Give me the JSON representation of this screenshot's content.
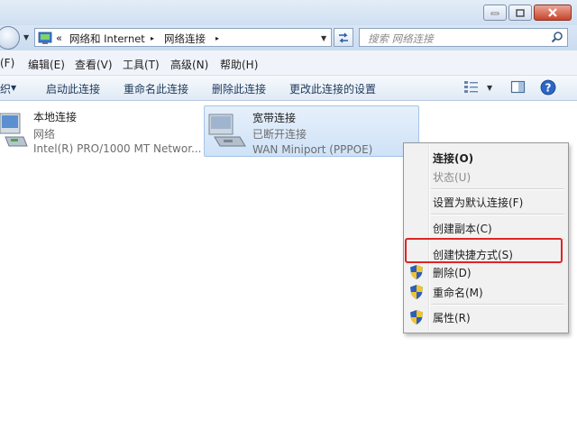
{
  "address": {
    "breadcrumb_prefix": "«",
    "crumb1": "网络和 Internet",
    "crumb2": "网络连接",
    "sep": "▸",
    "search_placeholder": "搜索 网络连接"
  },
  "menu": [
    "(F)",
    "编辑(E)",
    "查看(V)",
    "工具(T)",
    "高级(N)",
    "帮助(H)"
  ],
  "toolbar": {
    "organize_partial": "织",
    "start": "启动此连接",
    "rename": "重命名此连接",
    "delete": "删除此连接",
    "change_settings": "更改此连接的设置"
  },
  "connections": [
    {
      "name": "本地连接",
      "status": "网络",
      "device": "Intel(R) PRO/1000 MT Networ..."
    },
    {
      "name": "宽带连接",
      "status": "已断开连接",
      "device": "WAN Miniport (PPPOE)"
    }
  ],
  "context_menu": {
    "connect": "连接(O)",
    "status": "状态(U)",
    "set_default": "设置为默认连接(F)",
    "create_copy": "创建副本(C)",
    "create_shortcut": "创建快捷方式(S)",
    "delete": "删除(D)",
    "rename": "重命名(M)",
    "properties": "属性(R)"
  },
  "colors": {
    "highlight_border": "#e02424",
    "shield_blue": "#2d5fb8",
    "shield_yellow": "#f2c42c"
  }
}
